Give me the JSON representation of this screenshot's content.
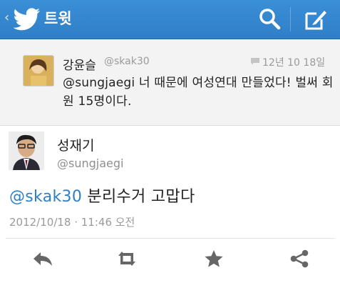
{
  "header": {
    "back": "‹",
    "title": "트윗",
    "icons": [
      "twitter-bird-icon",
      "search-icon",
      "compose-icon"
    ],
    "color": "#2f7fc7"
  },
  "quoted_tweet": {
    "name": "강윤슬",
    "handle": "@skak30",
    "time": "12년 10 18일",
    "mention": "@sungjaegi",
    "text_rest": " 너 때문에 여성연대 만들었다! 벌써 회원 15명이다."
  },
  "tweet": {
    "author_name": "성재기",
    "author_handle": "@sungjaegi",
    "mention": "@skak30",
    "text_rest": " 분리수거 고맙다",
    "timestamp": "2012/10/18 · 11:46 오전"
  },
  "actions": {
    "icons": [
      "reply-icon",
      "retweet-icon",
      "favorite-star-icon",
      "share-icon"
    ]
  }
}
